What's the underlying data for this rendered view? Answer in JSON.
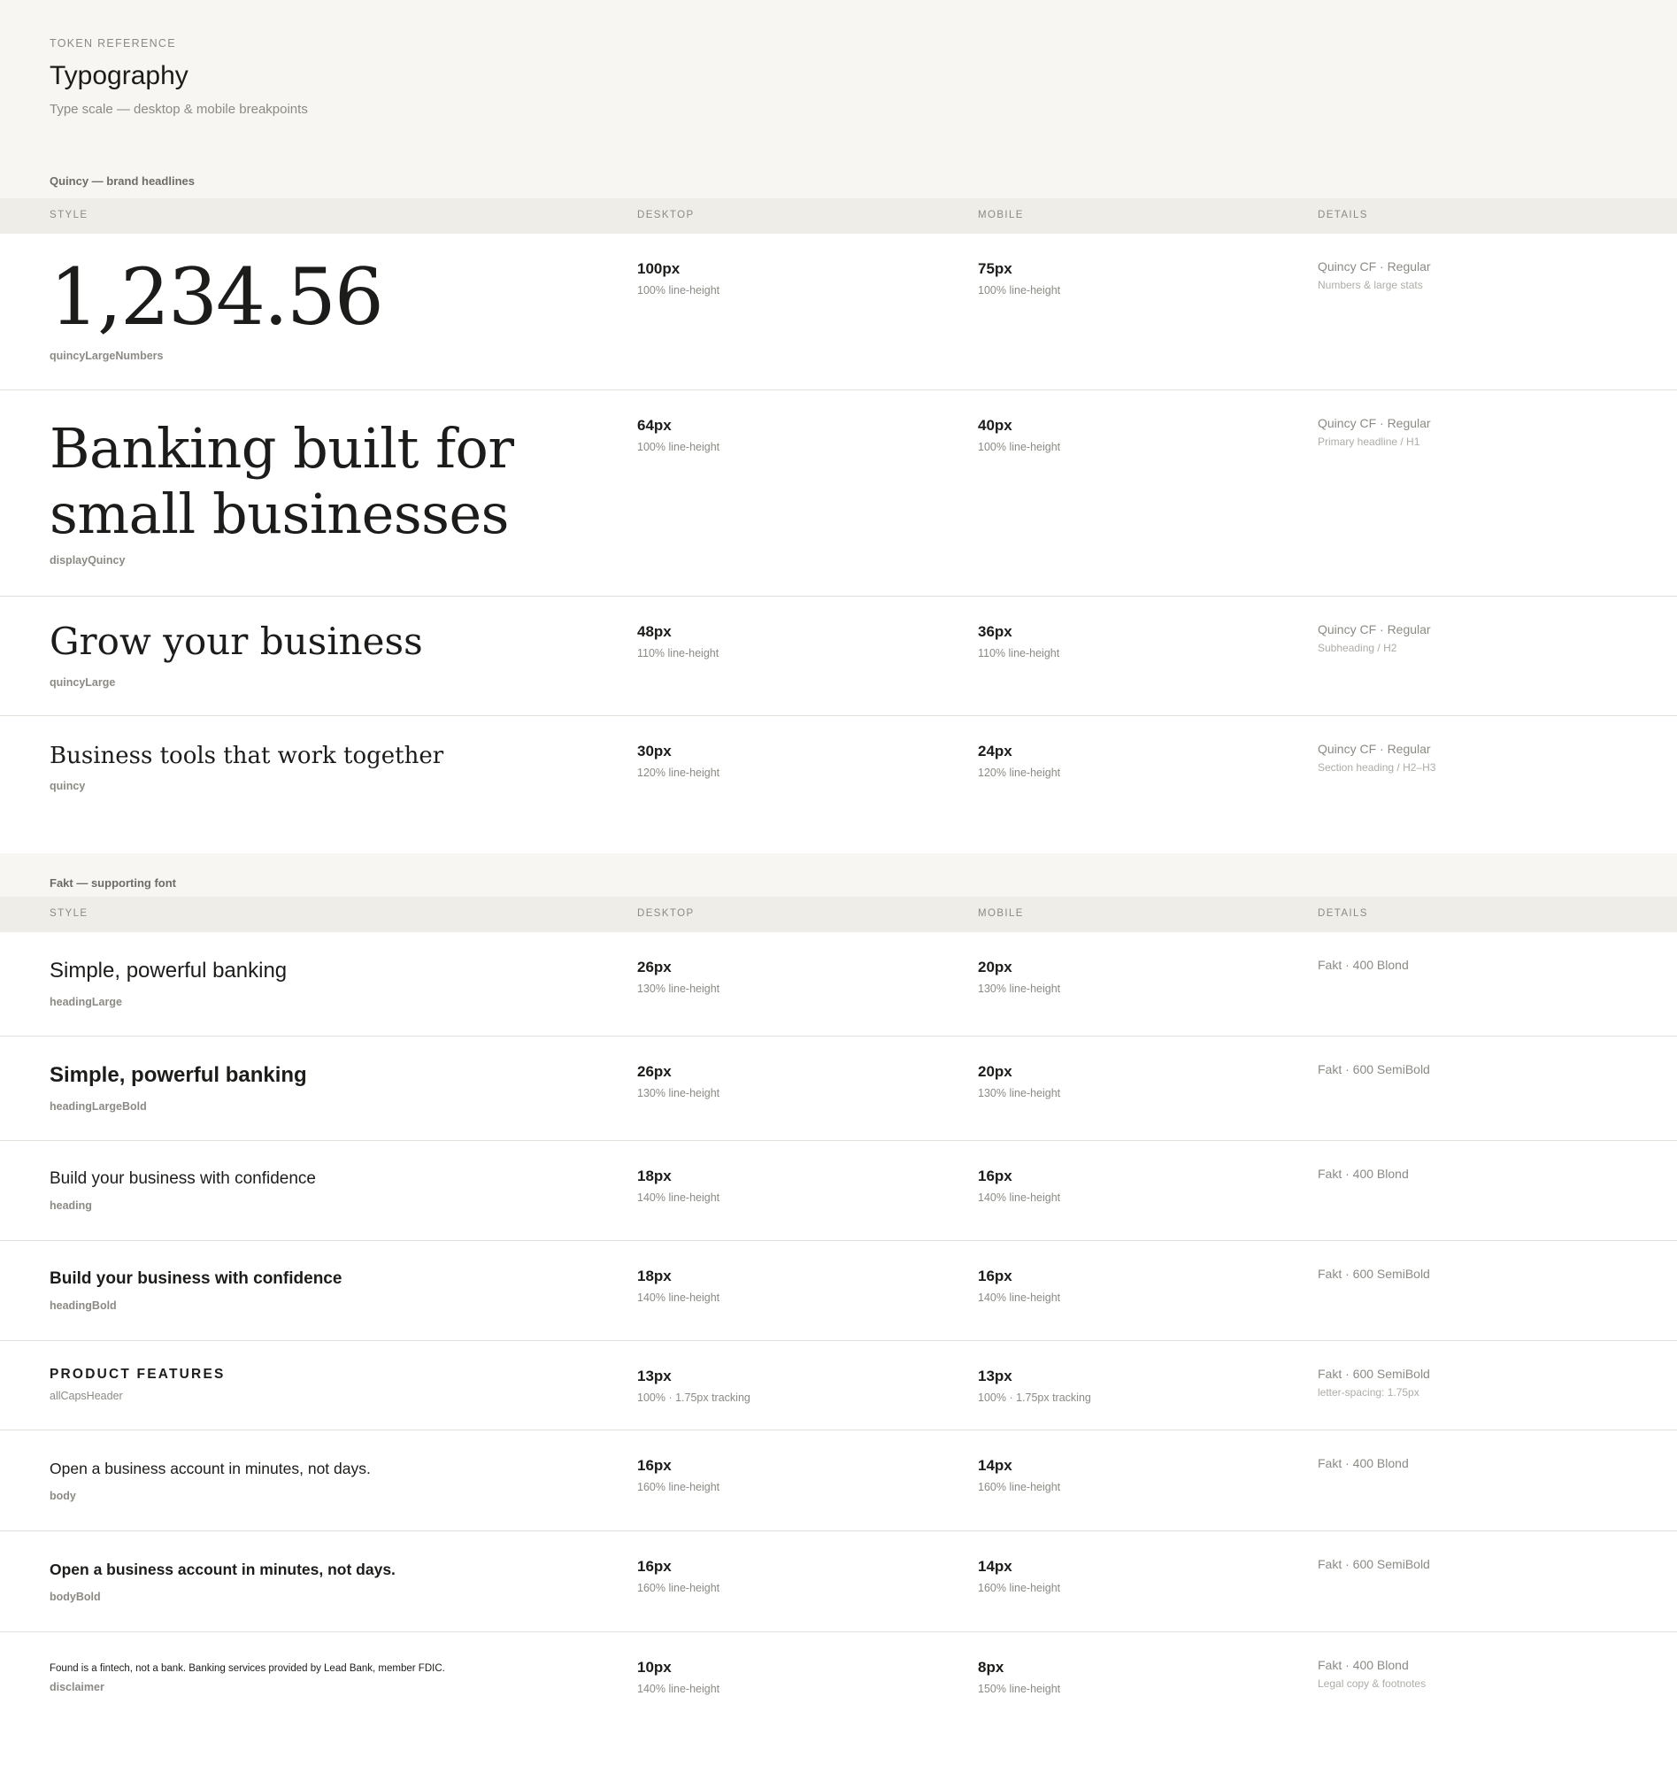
{
  "header": {
    "eyebrow": "TOKEN REFERENCE",
    "title": "Typography",
    "subtitle": "Type scale — desktop & mobile breakpoints"
  },
  "columns": {
    "style": "STYLE",
    "desktop": "DESKTOP",
    "mobile": "MOBILE",
    "details": "DETAILS"
  },
  "sections": [
    {
      "title": "Quincy — brand headlines",
      "rows": [
        {
          "sample": "1,234.56",
          "token": "quincyLargeNumbers",
          "desktop_size": "100px",
          "desktop_lh": "100% line-height",
          "mobile_size": "75px",
          "mobile_lh": "100% line-height",
          "face": "Quincy CF · Regular",
          "usage": "Numbers & large stats"
        },
        {
          "sample": "Banking built for small businesses",
          "token": "displayQuincy",
          "desktop_size": "64px",
          "desktop_lh": "100% line-height",
          "mobile_size": "40px",
          "mobile_lh": "100% line-height",
          "face": "Quincy CF · Regular",
          "usage": "Primary headline / H1"
        },
        {
          "sample": "Grow your business",
          "token": "quincyLarge",
          "desktop_size": "48px",
          "desktop_lh": "110% line-height",
          "mobile_size": "36px",
          "mobile_lh": "110% line-height",
          "face": "Quincy CF · Regular",
          "usage": "Subheading / H2"
        },
        {
          "sample": "Business tools that work together",
          "token": "quincy",
          "desktop_size": "30px",
          "desktop_lh": "120% line-height",
          "mobile_size": "24px",
          "mobile_lh": "120% line-height",
          "face": "Quincy CF · Regular",
          "usage": "Section heading / H2–H3"
        }
      ]
    },
    {
      "title": "Fakt — supporting font",
      "rows": [
        {
          "sample": "Simple, powerful banking",
          "token": "headingLarge",
          "desktop_size": "26px",
          "desktop_lh": "130% line-height",
          "mobile_size": "20px",
          "mobile_lh": "130% line-height",
          "face": "Fakt · 400 Blond"
        },
        {
          "sample": "Simple, powerful banking",
          "token": "headingLargeBold",
          "desktop_size": "26px",
          "desktop_lh": "130% line-height",
          "mobile_size": "20px",
          "mobile_lh": "130% line-height",
          "face": "Fakt · 600 SemiBold"
        },
        {
          "sample": "Build your business with confidence",
          "token": "heading",
          "desktop_size": "18px",
          "desktop_lh": "140% line-height",
          "mobile_size": "16px",
          "mobile_lh": "140% line-height",
          "face": "Fakt · 400 Blond"
        },
        {
          "sample": "Build your business with confidence",
          "token": "headingBold",
          "desktop_size": "18px",
          "desktop_lh": "140% line-height",
          "mobile_size": "16px",
          "mobile_lh": "140% line-height",
          "face": "Fakt · 600 SemiBold"
        },
        {
          "sample": "PRODUCT FEATURES",
          "token": "allCapsHeader",
          "desktop_size": "13px",
          "desktop_lh": "100% · 1.75px tracking",
          "mobile_size": "13px",
          "mobile_lh": "100% · 1.75px tracking",
          "face": "Fakt · 600 SemiBold",
          "usage": "letter-spacing: 1.75px"
        },
        {
          "sample": "Open a business account in minutes, not days.",
          "token": "body",
          "desktop_size": "16px",
          "desktop_lh": "160% line-height",
          "mobile_size": "14px",
          "mobile_lh": "160% line-height",
          "face": "Fakt · 400 Blond"
        },
        {
          "sample": "Open a business account in minutes, not days.",
          "token": "bodyBold",
          "desktop_size": "16px",
          "desktop_lh": "160% line-height",
          "mobile_size": "14px",
          "mobile_lh": "160% line-height",
          "face": "Fakt · 600 SemiBold"
        },
        {
          "sample": "Found is a fintech, not a bank. Banking services provided by Lead Bank, member FDIC.",
          "token": "disclaimer",
          "desktop_size": "10px",
          "desktop_lh": "140% line-height",
          "mobile_size": "8px",
          "mobile_lh": "150% line-height",
          "face": "Fakt · 400 Blond",
          "usage": "Legal copy & footnotes"
        }
      ]
    }
  ]
}
